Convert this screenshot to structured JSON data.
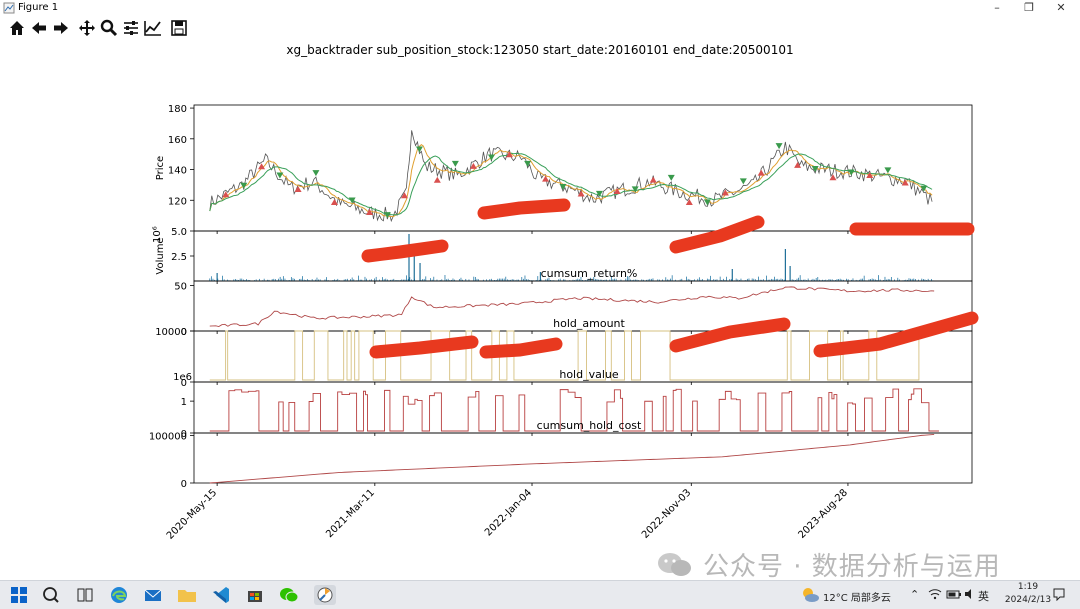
{
  "window": {
    "title": "Figure 1"
  },
  "toolbar": {
    "buttons": [
      "home-icon",
      "back-icon",
      "forward-icon",
      "pan-icon",
      "zoom-icon",
      "configure-subplots-icon",
      "edit-axis-icon",
      "save-icon"
    ]
  },
  "chart_data": {
    "type": "line",
    "title": "xg_backtrader sub_position_stock:123050 start_date:20160101 end_date:20500101",
    "x": {
      "tick_labels": [
        "2020-May-15",
        "2021-Mar-11",
        "2022-Jan-04",
        "2022-Nov-03",
        "2023-Aug-28"
      ],
      "range": [
        "2020-04-01",
        "2024-04-20"
      ]
    },
    "panels": [
      {
        "name": "price",
        "ylabel": "Price",
        "ylim": [
          100,
          182
        ],
        "yticks": [
          "120",
          "140",
          "160",
          "180"
        ],
        "type": "line",
        "series": [
          {
            "x": [
              "2020-05-01",
              "2020-07-01",
              "2020-08-15",
              "2020-10-01",
              "2020-11-15",
              "2021-01-01",
              "2021-03-01",
              "2021-04-15",
              "2021-05-10",
              "2021-05-20",
              "2021-06-15",
              "2021-08-15",
              "2021-10-15",
              "2021-12-15",
              "2022-01-15",
              "2022-03-15",
              "2022-05-01",
              "2022-06-15",
              "2022-08-15",
              "2022-10-15",
              "2022-12-15",
              "2023-03-01",
              "2023-04-15",
              "2023-05-01",
              "2023-06-01",
              "2023-07-15",
              "2023-09-15",
              "2023-11-01",
              "2023-12-15",
              "2024-02-08"
            ],
            "y": [
              118,
              130,
              146,
              128,
              132,
              118,
              112,
              110,
              124,
              168,
              142,
              136,
              150,
              148,
              134,
              128,
              121,
              126,
              132,
              125,
              120,
              130,
              148,
              155,
              142,
              140,
              138,
              135,
              133,
              118
            ]
          }
        ],
        "markers": {
          "buy_color": "#d9504f",
          "sell_color": "#3a9a4c"
        }
      },
      {
        "name": "volume",
        "ylabel": "Volume",
        "ylim": [
          0,
          5.0
        ],
        "yticks": [
          "2.5",
          "5.0"
        ],
        "exponent": "10^6",
        "type": "bar",
        "spikes": [
          {
            "x": "2020-05-15",
            "y": 0.8
          },
          {
            "x": "2021-05-15",
            "y": 4.7
          },
          {
            "x": "2021-05-25",
            "y": 3.1
          },
          {
            "x": "2021-06-05",
            "y": 1.8
          },
          {
            "x": "2022-01-20",
            "y": 0.9
          },
          {
            "x": "2023-01-20",
            "y": 1.2
          },
          {
            "x": "2023-05-01",
            "y": 3.2
          },
          {
            "x": "2023-05-10",
            "y": 1.5
          }
        ]
      },
      {
        "name": "cumsum_return%",
        "title": "cumsum_return%",
        "ylim": [
          0,
          55
        ],
        "yticks": [
          "0",
          "50"
        ],
        "type": "line",
        "series": [
          {
            "x": [
              "2020-05-01",
              "2020-08-01",
              "2020-09-01",
              "2020-11-15",
              "2021-03-01",
              "2021-05-01",
              "2021-05-20",
              "2021-07-01",
              "2021-12-15",
              "2022-04-01",
              "2022-09-01",
              "2022-12-01",
              "2023-02-01",
              "2023-05-01",
              "2023-09-01",
              "2023-12-01",
              "2024-02-08"
            ],
            "y": [
              5,
              8,
              22,
              14,
              16,
              18,
              38,
              26,
              30,
              36,
              32,
              38,
              36,
              48,
              44,
              45,
              44
            ]
          }
        ]
      },
      {
        "name": "hold_amount",
        "title": "hold_amount",
        "ylim": [
          0,
          10000
        ],
        "yticks": [
          "0",
          "10000"
        ],
        "type": "area",
        "note": "0/10000 toggles"
      },
      {
        "name": "hold_value",
        "title": "hold_value",
        "ylim": [
          0,
          1.6
        ],
        "yticks": [
          "0",
          "1"
        ],
        "exponent": "1e6",
        "type": "area"
      },
      {
        "name": "cumsum_hold_cost",
        "title": "cumsum_hold_cost",
        "ylim": [
          0,
          105000
        ],
        "yticks": [
          "0",
          "100000"
        ],
        "type": "line",
        "series": [
          {
            "x": [
              "2020-05-01",
              "2021-01-01",
              "2022-01-01",
              "2023-01-01",
              "2023-09-01",
              "2024-01-15",
              "2024-02-08"
            ],
            "y": [
              0,
              22000,
              40000,
              55000,
              80000,
              100000,
              102000
            ]
          }
        ]
      }
    ],
    "grid": false
  },
  "taskbar": {
    "weather": "12°C 局部多云",
    "lang": "英",
    "time": "1:19",
    "date": "2024/2/13"
  },
  "watermark": "公众号 · 数据分析与运用"
}
